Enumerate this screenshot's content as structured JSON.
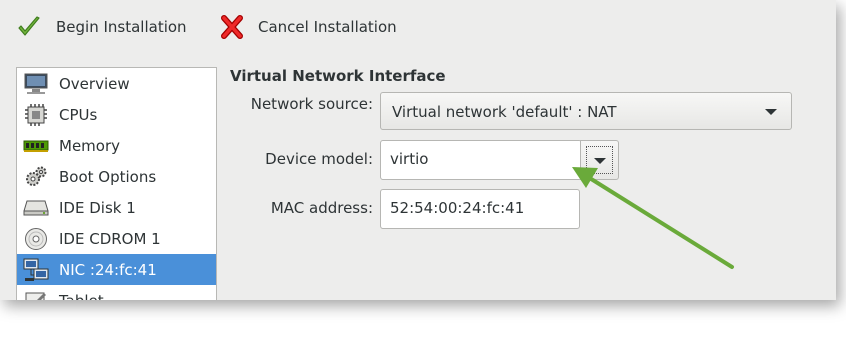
{
  "toolbar": {
    "begin_label": "Begin Installation",
    "cancel_label": "Cancel Installation"
  },
  "sidebar": {
    "items": [
      {
        "label": "Overview",
        "icon": "monitor-icon"
      },
      {
        "label": "CPUs",
        "icon": "cpu-icon"
      },
      {
        "label": "Memory",
        "icon": "memory-icon"
      },
      {
        "label": "Boot Options",
        "icon": "gears-icon"
      },
      {
        "label": "IDE Disk 1",
        "icon": "disk-icon"
      },
      {
        "label": "IDE CDROM 1",
        "icon": "cdrom-icon"
      },
      {
        "label": "NIC :24:fc:41",
        "icon": "network-icon",
        "selected": true
      },
      {
        "label": "Tablet",
        "icon": "tablet-icon"
      }
    ]
  },
  "details": {
    "title": "Virtual Network Interface",
    "network_source": {
      "label": "Network source:",
      "value": "Virtual network 'default' : NAT"
    },
    "device_model": {
      "label": "Device model:",
      "value": "virtio"
    },
    "mac_address": {
      "label": "MAC address:",
      "value": "52:54:00:24:fc:41"
    }
  },
  "colors": {
    "selection": "#4a90d9",
    "annotation_arrow": "#6aaa3a",
    "window_bg": "#ededec"
  }
}
